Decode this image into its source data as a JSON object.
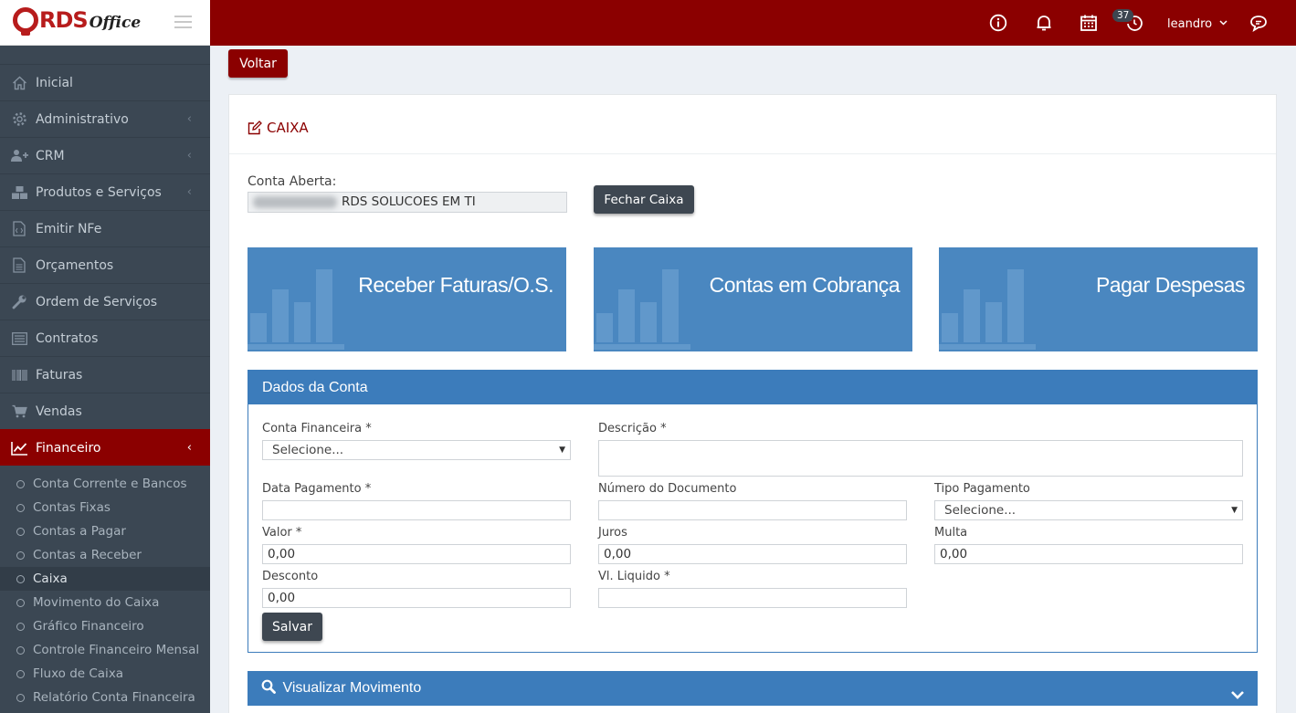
{
  "brand": {
    "logo_text": "RDS",
    "logo_suffix": "Office"
  },
  "sidebar": {
    "items": [
      {
        "label": "Inicial",
        "icon": "home-icon"
      },
      {
        "label": "Administrativo",
        "icon": "gear-icon",
        "chevron": "‹"
      },
      {
        "label": "CRM",
        "icon": "users-icon",
        "chevron": "‹"
      },
      {
        "label": "Produtos e Serviços",
        "icon": "cubes-icon",
        "chevron": "‹"
      },
      {
        "label": "Emitir NFe",
        "icon": "file-code-icon"
      },
      {
        "label": "Orçamentos",
        "icon": "file-text-icon"
      },
      {
        "label": "Ordem de Serviços",
        "icon": "wrench-icon"
      },
      {
        "label": "Contratos",
        "icon": "list-icon"
      },
      {
        "label": "Faturas",
        "icon": "barcode-icon"
      },
      {
        "label": "Vendas",
        "icon": "cart-icon"
      },
      {
        "label": "Financeiro",
        "icon": "chart-line-icon",
        "chevron": "‹",
        "active": true
      }
    ],
    "subitems": [
      "Conta Corrente e Bancos",
      "Contas Fixas",
      "Contas a Pagar",
      "Contas a Receber",
      "Caixa",
      "Movimento do Caixa",
      "Gráfico Financeiro",
      "Controle Financeiro Mensal",
      "Fluxo de Caixa",
      "Relatório Conta Financeira"
    ]
  },
  "topbar": {
    "badge": "37",
    "user": "leandro",
    "user_chevron": "⌄"
  },
  "content": {
    "back_label": "Voltar",
    "title": "CAIXA",
    "conta_label": "Conta Aberta:",
    "conta_value": "RDS SOLUCOES EM TI",
    "fechar_label": "Fechar Caixa",
    "tiles": [
      "Receber Faturas/O.S.",
      "Contas em Cobrança",
      "Pagar Despesas"
    ],
    "dados": {
      "title": "Dados da Conta",
      "conta_financeira_label": "Conta Financeira *",
      "conta_financeira_value": "Selecione...",
      "descricao_label": "Descrição *",
      "data_pagamento_label": "Data Pagamento *",
      "numero_documento_label": "Número do Documento",
      "tipo_pagamento_label": "Tipo Pagamento",
      "tipo_pagamento_value": "Selecione...",
      "valor_label": "Valor *",
      "valor_value": "0,00",
      "juros_label": "Juros",
      "juros_value": "0,00",
      "multa_label": "Multa",
      "multa_value": "0,00",
      "desconto_label": "Desconto",
      "desconto_value": "0,00",
      "vl_liquido_label": "Vl. Liquido *",
      "salvar_label": "Salvar"
    },
    "visualizar_label": "Visualizar Movimento"
  },
  "colors": {
    "brand_red": "#8b0000",
    "sidebar": "#3b4753",
    "accent_blue": "#3c7cbb",
    "tile_blue": "#4a87c0"
  }
}
